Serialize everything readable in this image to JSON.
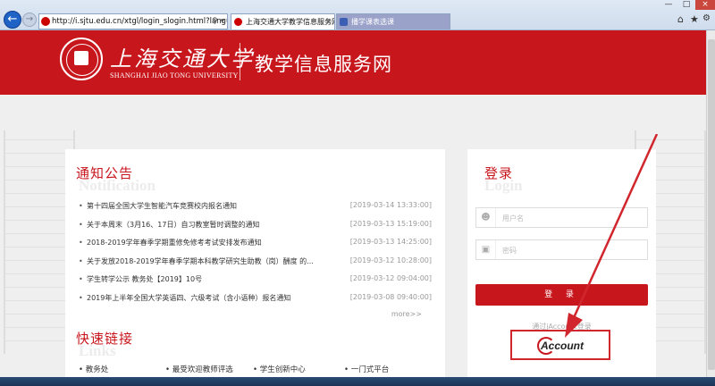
{
  "browser": {
    "address_url": "http://i.sjtu.edu.cn/xtgl/login_slogin.html?languag",
    "tabs": [
      {
        "label": "上海交通大学教学信息服务网"
      },
      {
        "label": "播学课表选课"
      }
    ]
  },
  "header": {
    "logo_cn": "上海交通大学",
    "logo_en": "SHANGHAI JIAO TONG UNIVERSITY",
    "title": "教学信息服务网"
  },
  "notices": {
    "heading_cn": "通知公告",
    "heading_en": "Notification",
    "items": [
      {
        "text": "第十四届全国大学生智能汽车竞赛校内报名通知",
        "date": "[2019-03-14 13:33:00]"
      },
      {
        "text": "关于本周末（3月16、17日）自习教室暂时调整的通知",
        "date": "[2019-03-13 15:19:00]"
      },
      {
        "text": "2018-2019学年春季学期重修免修考考试安排发布通知",
        "date": "[2019-03-13 14:25:00]"
      },
      {
        "text": "关于发放2018-2019学年春季学期本科教学研究生助教（岗）酬度 的...",
        "date": "[2019-03-12 10:28:00]"
      },
      {
        "text": "学生转学公示 教务处【2019】10号",
        "date": "[2019-03-12 09:04:00]"
      },
      {
        "text": "2019年上半年全国大学英语四、六级考试（含小语种）报名通知",
        "date": "[2019-03-08 09:40:00]"
      }
    ],
    "more_label": "more>>"
  },
  "quick_links": {
    "heading_cn": "快速链接",
    "heading_en": "Links",
    "items": [
      "教务处",
      "最受欢迎教师评选",
      "学生创新中心",
      "一门式平台"
    ]
  },
  "login": {
    "heading_cn": "登录",
    "heading_en": "Login",
    "username_placeholder": "用户名",
    "password_placeholder": "密码",
    "button_label": "登 录",
    "jaccount_hint": "通过jAccount登录",
    "jaccount_label": "Account"
  },
  "colors": {
    "brand_red": "#c8161d",
    "annotation_red": "#d1262d"
  }
}
